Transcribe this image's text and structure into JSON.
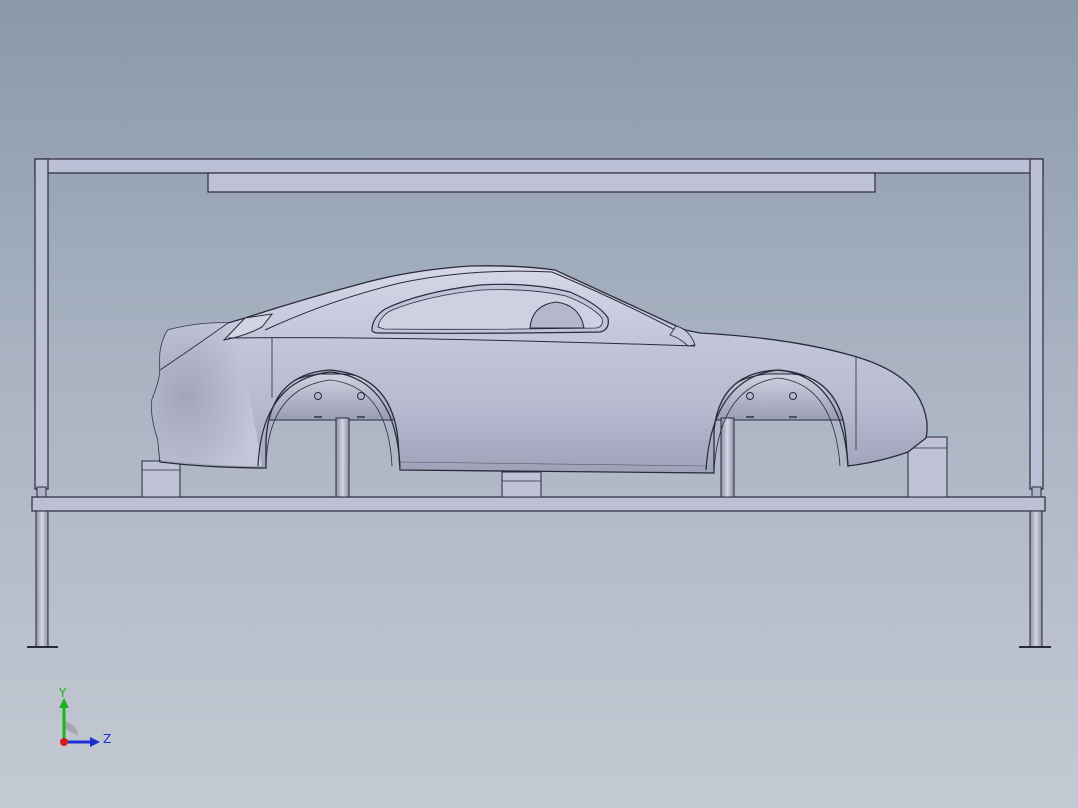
{
  "viewport": {
    "background_top": "#8a98aa",
    "background_bottom": "#c4cad3"
  },
  "model": {
    "frame_color": "#bcc0d6",
    "body_color": "#c5c8dc",
    "edge_color": "#2a2a3a"
  },
  "triad": {
    "y_label": "Y",
    "z_label": "Z",
    "y_color": "#1db31d",
    "z_color": "#1a2fd6",
    "x_color": "#d41c1c"
  }
}
